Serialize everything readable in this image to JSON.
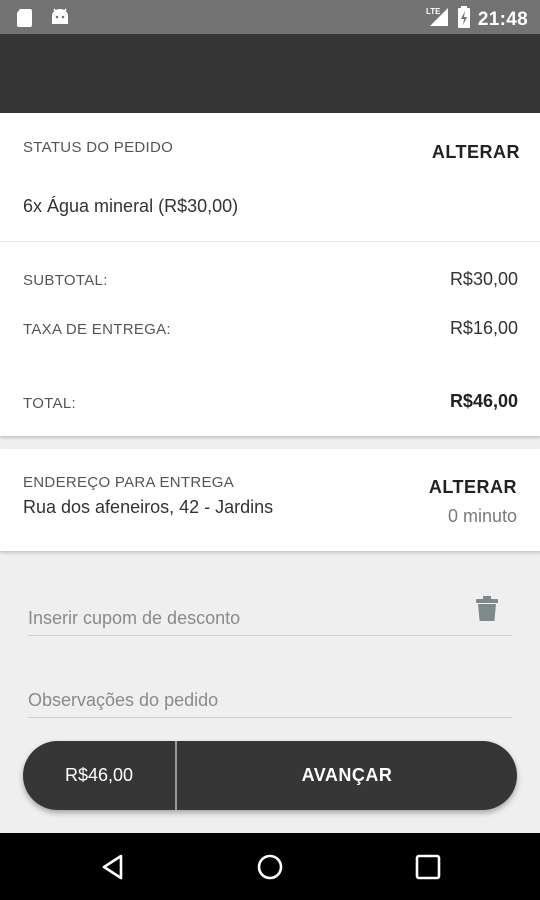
{
  "status_bar": {
    "time": "21:48",
    "network": "LTE",
    "icons": [
      "sd-card-icon",
      "android-icon",
      "signal-icon",
      "battery-charging-icon"
    ]
  },
  "order": {
    "section_label": "STATUS DO PEDIDO",
    "change_label": "ALTERAR",
    "item": "6x Água mineral (R$30,00)",
    "subtotal_label": "SUBTOTAL:",
    "subtotal_value": "R$30,00",
    "delivery_fee_label": "TAXA DE ENTREGA:",
    "delivery_fee_value": "R$16,00",
    "total_label": "TOTAL:",
    "total_value": "R$46,00"
  },
  "address": {
    "section_label": "ENDEREÇO PARA ENTREGA",
    "value": "Rua dos afeneiros, 42 - Jardins",
    "change_label": "ALTERAR",
    "eta": "0 minuto"
  },
  "coupon": {
    "placeholder": "Inserir cupom de desconto"
  },
  "notes": {
    "placeholder": "Observações do pedido"
  },
  "cta": {
    "price": "R$46,00",
    "advance_label": "AVANÇAR"
  },
  "colors": {
    "app_bar": "#363636",
    "status_bar": "#737373",
    "background": "#efefef",
    "button": "#363636"
  }
}
